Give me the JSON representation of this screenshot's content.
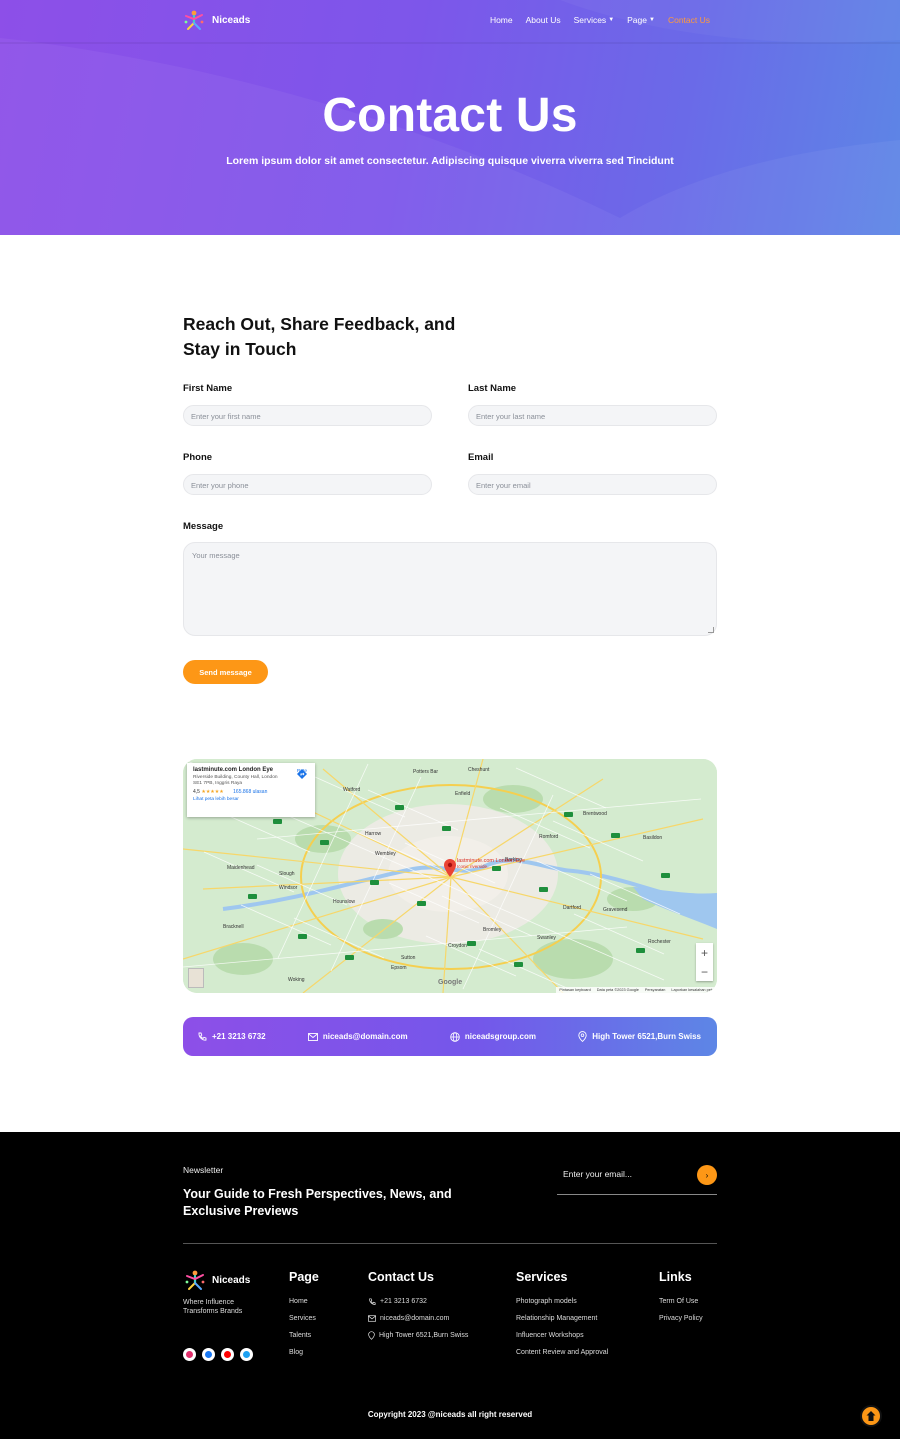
{
  "nav": {
    "brand": "Niceads",
    "links": [
      {
        "label": "Home",
        "dropdown": false,
        "active": false
      },
      {
        "label": "About Us",
        "dropdown": false,
        "active": false
      },
      {
        "label": "Services",
        "dropdown": true,
        "active": false
      },
      {
        "label": "Page",
        "dropdown": true,
        "active": false
      },
      {
        "label": "Contact Us",
        "dropdown": false,
        "active": true
      }
    ]
  },
  "hero": {
    "title": "Contact Us",
    "subtitle": "Lorem ipsum dolor sit amet consectetur. Adipiscing quisque viverra viverra sed Tincidunt"
  },
  "form": {
    "heading": "Reach Out, Share Feedback, and Stay in Touch",
    "first_name": {
      "label": "First Name",
      "placeholder": "Enter your first name"
    },
    "last_name": {
      "label": "Last Name",
      "placeholder": "Enter your last name"
    },
    "phone": {
      "label": "Phone",
      "placeholder": "Enter your phone"
    },
    "email": {
      "label": "Email",
      "placeholder": "Enter your email"
    },
    "message": {
      "label": "Message",
      "placeholder": "Your message"
    },
    "submit_label": "Send message"
  },
  "map": {
    "card": {
      "title": "lastminute.com London Eye",
      "address": "Riverside Building, County Hall, London SE1 7PB, Inggris Raya",
      "rating": "4,5",
      "stars": "★★★★★",
      "reviews": "165.868 ulasan",
      "larger_map": "Lihat peta lebih besar",
      "route": "Rute"
    },
    "pin_label": "lastminute.com London Eye",
    "pin_sublabel": "Iconic riverside...",
    "zoom_in": "+",
    "zoom_out": "−",
    "google": "Google",
    "attribution": [
      "Pintasan keyboard",
      "Data peta ©2023 Google",
      "Persyaratan",
      "Laporkan kesalahan peta"
    ],
    "places": [
      {
        "name": "Watford"
      },
      {
        "name": "Potters Bar"
      },
      {
        "name": "Enfield"
      },
      {
        "name": "Cheshunt"
      },
      {
        "name": "Harrow"
      },
      {
        "name": "Romford"
      },
      {
        "name": "Brentwood"
      },
      {
        "name": "Slough"
      },
      {
        "name": "Windsor"
      },
      {
        "name": "Hounslow"
      },
      {
        "name": "Croydon"
      },
      {
        "name": "Bromley"
      },
      {
        "name": "Dartford"
      },
      {
        "name": "Sutton"
      },
      {
        "name": "Epsom"
      },
      {
        "name": "Woking"
      },
      {
        "name": "Maidenhead"
      },
      {
        "name": "Bracknell"
      },
      {
        "name": "Basildon"
      },
      {
        "name": "Gravesend"
      },
      {
        "name": "Rochester"
      },
      {
        "name": "Swanley"
      },
      {
        "name": "Barking"
      },
      {
        "name": "Wembley"
      }
    ]
  },
  "contact_bar": {
    "phone": "+21 3213 6732",
    "email": "niceads@domain.com",
    "website": "niceadsgroup.com",
    "address": "High Tower 6521,Burn Swiss"
  },
  "footer": {
    "newsletter_label": "Newsletter",
    "newsletter_heading": "Your Guide to Fresh Perspectives, News, and Exclusive Previews",
    "newsletter_placeholder": "Enter your email...",
    "newsletter_button": "›",
    "brand": "Niceads",
    "tagline": "Where Influence Transforms Brands",
    "socials": [
      {
        "icon": "instagram-icon",
        "color": "#e1306c"
      },
      {
        "icon": "facebook-icon",
        "color": "#1877f2"
      },
      {
        "icon": "youtube-icon",
        "color": "#ff0000"
      },
      {
        "icon": "twitter-icon",
        "color": "#1da1f2"
      }
    ],
    "columns": {
      "page": {
        "title": "Page",
        "items": [
          "Home",
          "Services",
          "Talents",
          "Blog"
        ]
      },
      "contact": {
        "title": "Contact Us",
        "items": [
          "+21 3213 6732",
          "niceads@domain.com",
          "High Tower 6521,Burn Swiss"
        ]
      },
      "services": {
        "title": "Services",
        "items": [
          "Photograph models",
          "Relationship Management",
          "Influencer Workshops",
          "Content Review and Approval"
        ]
      },
      "links": {
        "title": "Links",
        "items": [
          "Term Of Use",
          "Privacy Policy"
        ]
      }
    },
    "copyright": "Copyright 2023 @niceads all right reserved"
  },
  "colors": {
    "accent": "#fd9716",
    "purple": "#8d4fe8",
    "blue": "#5d86e6",
    "active_nav": "#ff9a3c"
  }
}
